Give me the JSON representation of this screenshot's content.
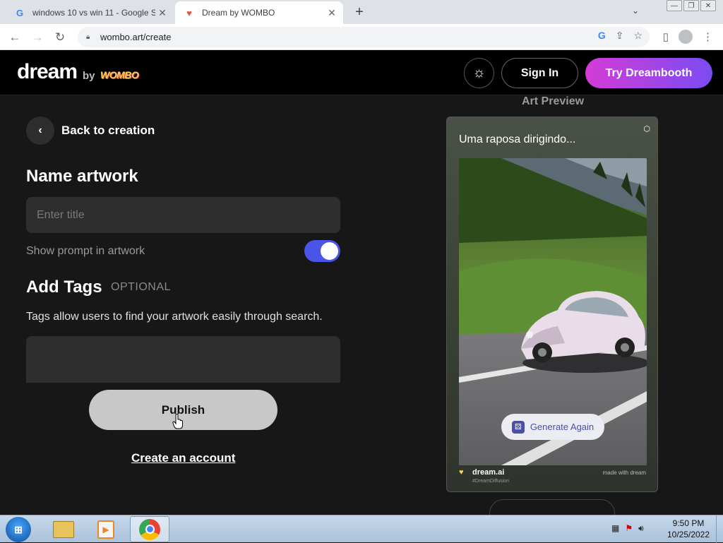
{
  "browser": {
    "tabs": [
      {
        "title": "windows 10 vs win 11 - Google S",
        "favicon": "google-g-icon"
      },
      {
        "title": "Dream by WOMBO",
        "favicon": "wombo-icon"
      }
    ],
    "url": "wombo.art/create"
  },
  "site_header": {
    "logo": "dream",
    "by": "by",
    "brand": "WOMBO",
    "signin": "Sign In",
    "try_dreambooth": "Try Dreambooth",
    "theme_icon": "sun-icon"
  },
  "form": {
    "back_label": "Back to creation",
    "name_heading": "Name artwork",
    "title_placeholder": "Enter title",
    "show_prompt_label": "Show prompt in artwork",
    "show_prompt_on": true,
    "tags_heading": "Add Tags",
    "tags_optional": "OPTIONAL",
    "tags_description": "Tags allow users to find your artwork easily through search.",
    "publish": "Publish",
    "create_account": "Create an account"
  },
  "preview": {
    "label": "Art Preview",
    "prompt": "Uma raposa dirigindo...",
    "generate_again": "Generate Again",
    "site": "dream.ai",
    "hashtag": "#DreamDiffusion",
    "made_with": "made with dream"
  },
  "taskbar": {
    "time": "9:50 PM",
    "date": "10/25/2022"
  },
  "colors": {
    "accent_purple": "#7a4cf2",
    "accent_pink": "#d43cd6",
    "toggle_on": "#4a55e8",
    "background": "#171717"
  }
}
